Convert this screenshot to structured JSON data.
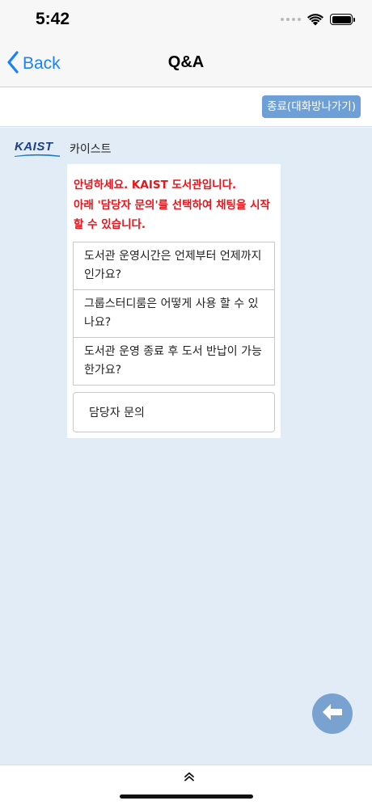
{
  "status_bar": {
    "time": "5:42"
  },
  "nav": {
    "back_label": "Back",
    "title": "Q&A"
  },
  "toolbar": {
    "end_chat_label": "종료(대화방나가기)"
  },
  "bot": {
    "logo_text": "KAIST",
    "name": "카이스트"
  },
  "message": {
    "greeting": "안녕하세요. KAIST 도서관입니다.\n아래 '담당자 문의'를 선택하여 채팅을 시작\n할 수 있습니다.",
    "options": [
      {
        "label": "도서관 운영시간은 언제부터 언제까지인가요?"
      },
      {
        "label": "그룹스터디룸은 어떻게 사용 할 수 있나요?"
      },
      {
        "label": "도서관 운영 종료 후 도서 반납이 가능한가요?"
      }
    ],
    "contact_label": "담당자 문의"
  },
  "icons": {
    "back": "chevron-left-icon",
    "fab": "arrow-left-icon",
    "expand": "double-chevron-up-icon"
  },
  "colors": {
    "accent": "#1a82f7",
    "end_button": "#6e9fd6",
    "chat_bg": "#e2ecf6",
    "greeting_text": "#e8141b",
    "fab": "#7aa2d0"
  }
}
